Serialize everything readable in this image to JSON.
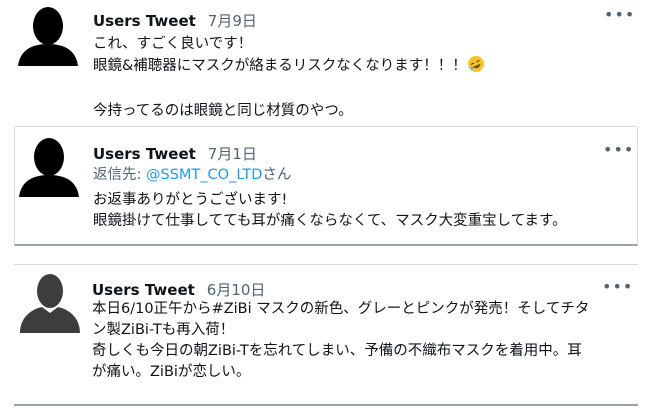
{
  "tweets": [
    {
      "avatar_icon": "person-silhouette-icon",
      "name": "Users Tweet",
      "date": "7月9日",
      "more_icon": "more-options-icon",
      "lines": [
        "これ、すごく良いです！",
        "眼鏡&補聴器にマスクが絡まるリスクなくなります！！！",
        "",
        "今持ってるのは眼鏡と同じ材質のやつ。"
      ],
      "emoji": "rolling-on-floor-laughing-icon"
    },
    {
      "avatar_icon": "person-silhouette-icon",
      "name": "Users Tweet",
      "date": "7月1日",
      "more_icon": "more-options-icon",
      "reply_prefix": "返信先: ",
      "reply_handle": "@SSMT_CO_LTD",
      "reply_suffix": "さん",
      "lines": [
        "お返事ありがとうございます!",
        "眼鏡掛けて仕事してても耳が痛くならなくて、マスク大変重宝してます。"
      ]
    },
    {
      "avatar_icon": "default-profile-icon",
      "name": "Users Tweet",
      "date": "6月10日",
      "more_icon": "more-options-icon",
      "lines": [
        "本日6/10正午から#ZiBi マスクの新色、グレーとピンクが発売！そしてチタ",
        "ン製ZiBi-Tも再入荷！",
        "奇しくも今日の朝ZiBi-Tを忘れてしまい、予備の不織布マスクを着用中。耳",
        "が痛い。ZiBiが恋しい。"
      ]
    }
  ],
  "colors": {
    "text": "#0f1419",
    "muted": "#536471",
    "link": "#1d9bf0"
  }
}
